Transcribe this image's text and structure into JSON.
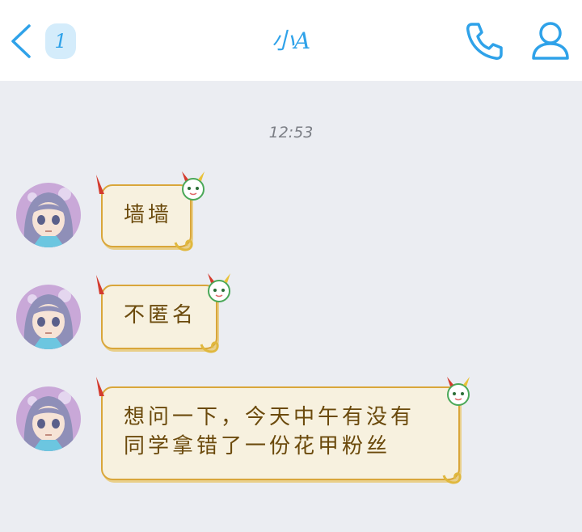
{
  "header": {
    "back_icon": "chevron-left-icon",
    "unread_count": "1",
    "title": "小A",
    "call_icon": "phone-icon",
    "profile_icon": "person-icon"
  },
  "timestamp": "12:53",
  "messages": [
    {
      "sender": "other",
      "text": "墙墙"
    },
    {
      "sender": "other",
      "text": "不匿名"
    },
    {
      "sender": "other",
      "text": "想问一下，今天中午有没有\n同学拿错了一份花甲粉丝"
    }
  ],
  "colors": {
    "accent": "#2fa2e9",
    "badge_bg": "#d4ecfb",
    "chat_bg": "#ebedf2",
    "bubble_fill": "#f7f1df",
    "bubble_border": "#d9a63a",
    "bubble_text": "#6b4a0c"
  }
}
